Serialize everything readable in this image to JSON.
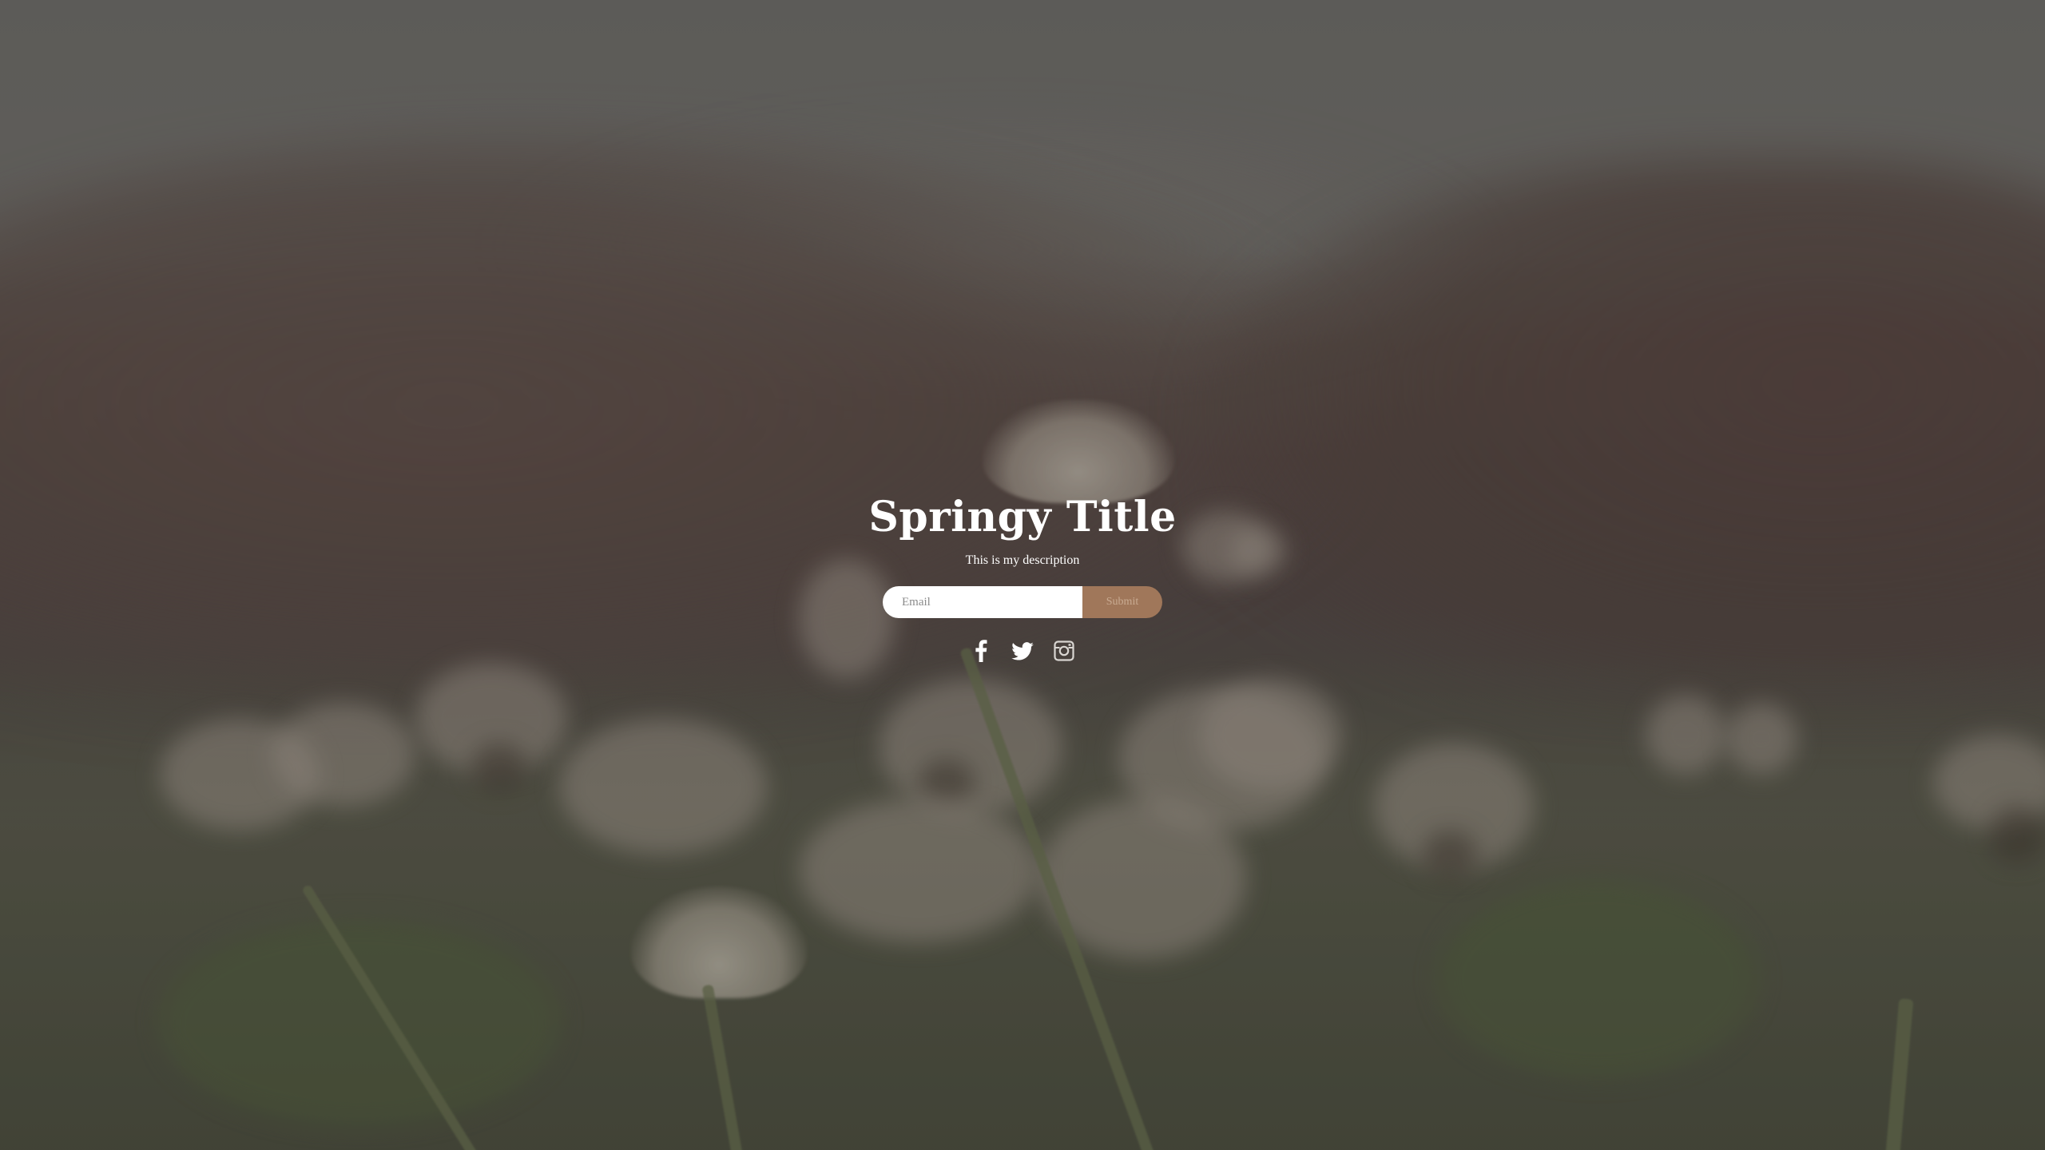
{
  "hero": {
    "title": "Springy Title",
    "description": "This is my description"
  },
  "signup_form": {
    "email_placeholder": "Email",
    "email_value": "",
    "submit_label": "Submit"
  },
  "social_links": [
    {
      "name": "facebook",
      "icon": "facebook-icon"
    },
    {
      "name": "twitter",
      "icon": "twitter-icon"
    },
    {
      "name": "instagram",
      "icon": "instagram-icon"
    }
  ],
  "colors": {
    "submit_background": "#a0775a",
    "submit_text": "#c9ab92",
    "text": "#ffffff",
    "input_background": "#ffffff"
  }
}
